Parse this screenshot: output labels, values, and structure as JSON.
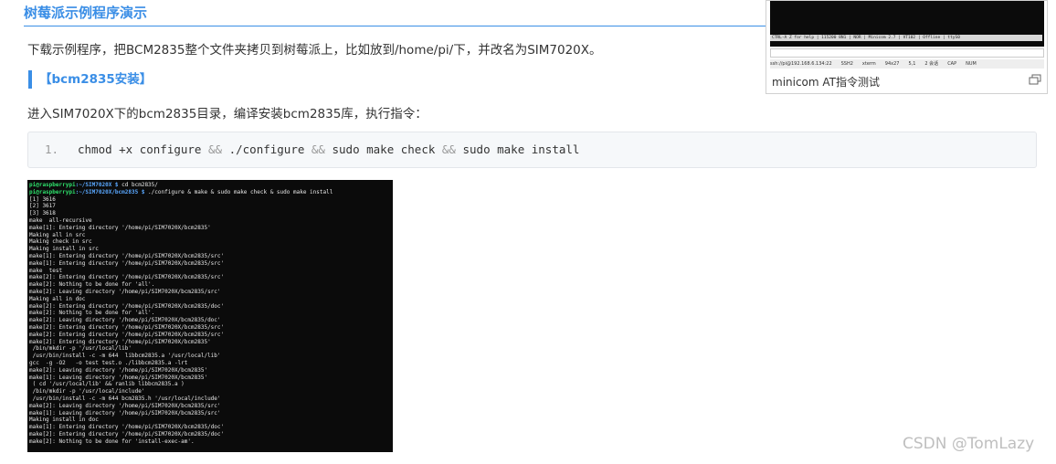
{
  "section_title": "树莓派示例程序演示",
  "intro": "下载示例程序，把BCM2835整个文件夹拷贝到树莓派上，比如放到/home/pi/下，并改名为SIM7020X。",
  "subhead": "【bcm2835安装】",
  "step": "进入SIM7020X下的bcm2835目录，编译安装bcm2835库，执行指令：",
  "code": {
    "line_no": "1.",
    "parts": [
      "chmod +x configure ",
      "&&",
      " ./configure ",
      "&&",
      " sudo make check ",
      "&&",
      " sudo make install"
    ]
  },
  "terminal": {
    "prompt_user": "pi@raspberrypi",
    "lines": [
      {
        "prompt": true,
        "path": ":~/SIM7020X $",
        "cmd": " cd bcm2835/"
      },
      {
        "prompt": true,
        "path": ":~/SIM7020X/bcm2835 $",
        "cmd": " ./configure & make & sudo make check & sudo make install"
      },
      {
        "text": "[1] 3616"
      },
      {
        "text": "[2] 3617"
      },
      {
        "text": "[3] 3618"
      },
      {
        "text": "make  all-recursive"
      },
      {
        "text": "make[1]: Entering directory '/home/pi/SIM7020X/bcm2835'"
      },
      {
        "text": "Making all in src"
      },
      {
        "text": "Making check in src"
      },
      {
        "text": "Making install in src"
      },
      {
        "text": "make[1]: Entering directory '/home/pi/SIM7020X/bcm2835/src'"
      },
      {
        "text": "make[1]: Entering directory '/home/pi/SIM7020X/bcm2835/src'"
      },
      {
        "text": "make  test"
      },
      {
        "text": "make[2]: Entering directory '/home/pi/SIM7020X/bcm2835/src'"
      },
      {
        "text": "make[2]: Nothing to be done for 'all'."
      },
      {
        "text": "make[2]: Leaving directory '/home/pi/SIM7020X/bcm2835/src'"
      },
      {
        "text": "Making all in doc"
      },
      {
        "text": "make[2]: Entering directory '/home/pi/SIM7020X/bcm2835/doc'"
      },
      {
        "text": "make[2]: Nothing to be done for 'all'."
      },
      {
        "text": "make[2]: Leaving directory '/home/pi/SIM7020X/bcm2835/doc'"
      },
      {
        "text": "make[2]: Entering directory '/home/pi/SIM7020X/bcm2835/src'"
      },
      {
        "text": "make[2]: Entering directory '/home/pi/SIM7020X/bcm2835/src'"
      },
      {
        "text": "make[2]: Entering directory '/home/pi/SIM7020X/bcm2835'"
      },
      {
        "text": " /bin/mkdir -p '/usr/local/lib'"
      },
      {
        "text": " /usr/bin/install -c -m 644  libbcm2835.a '/usr/local/lib'"
      },
      {
        "text": "gcc  -g -O2   -o test test.o ./libbcm2835.a -lrt"
      },
      {
        "text": "make[2]: Leaving directory '/home/pi/SIM7020X/bcm2835'"
      },
      {
        "text": "make[1]: Leaving directory '/home/pi/SIM7020X/bcm2835'"
      },
      {
        "text": " ( cd '/usr/local/lib' && ranlib libbcm2835.a )"
      },
      {
        "text": " /bin/mkdir -p '/usr/local/include'"
      },
      {
        "text": " /usr/bin/install -c -m 644 bcm2835.h '/usr/local/include'"
      },
      {
        "text": "make[2]: Leaving directory '/home/pi/SIM7020X/bcm2835/src'"
      },
      {
        "text": "make[1]: Leaving directory '/home/pi/SIM7020X/bcm2835/src'"
      },
      {
        "text": "Making install in doc"
      },
      {
        "text": "make[1]: Entering directory '/home/pi/SIM7020X/bcm2835/doc'"
      },
      {
        "text": "make[2]: Entering directory '/home/pi/SIM7020X/bcm2835/doc'"
      },
      {
        "text": "make[2]: Nothing to be done for 'install-exec-am'."
      }
    ]
  },
  "thumbnail": {
    "status_line": "CTRL-A Z for help | 115200 8N1 | NOR | Minicom 2.7 | VT102 | Offline | ttyS0",
    "statusbar": [
      "ssh://pi@192.168.6.134:22",
      "SSH2",
      "xterm",
      "94x27",
      "5,1",
      "2 会话",
      "CAP",
      "NUM"
    ],
    "caption": "minicom AT指令测试"
  },
  "watermark": "CSDN @TomLazy",
  "colors": {
    "accent": "#3a8ee6",
    "prompt_user": "#2ee06b",
    "prompt_path": "#5aa8ff"
  }
}
